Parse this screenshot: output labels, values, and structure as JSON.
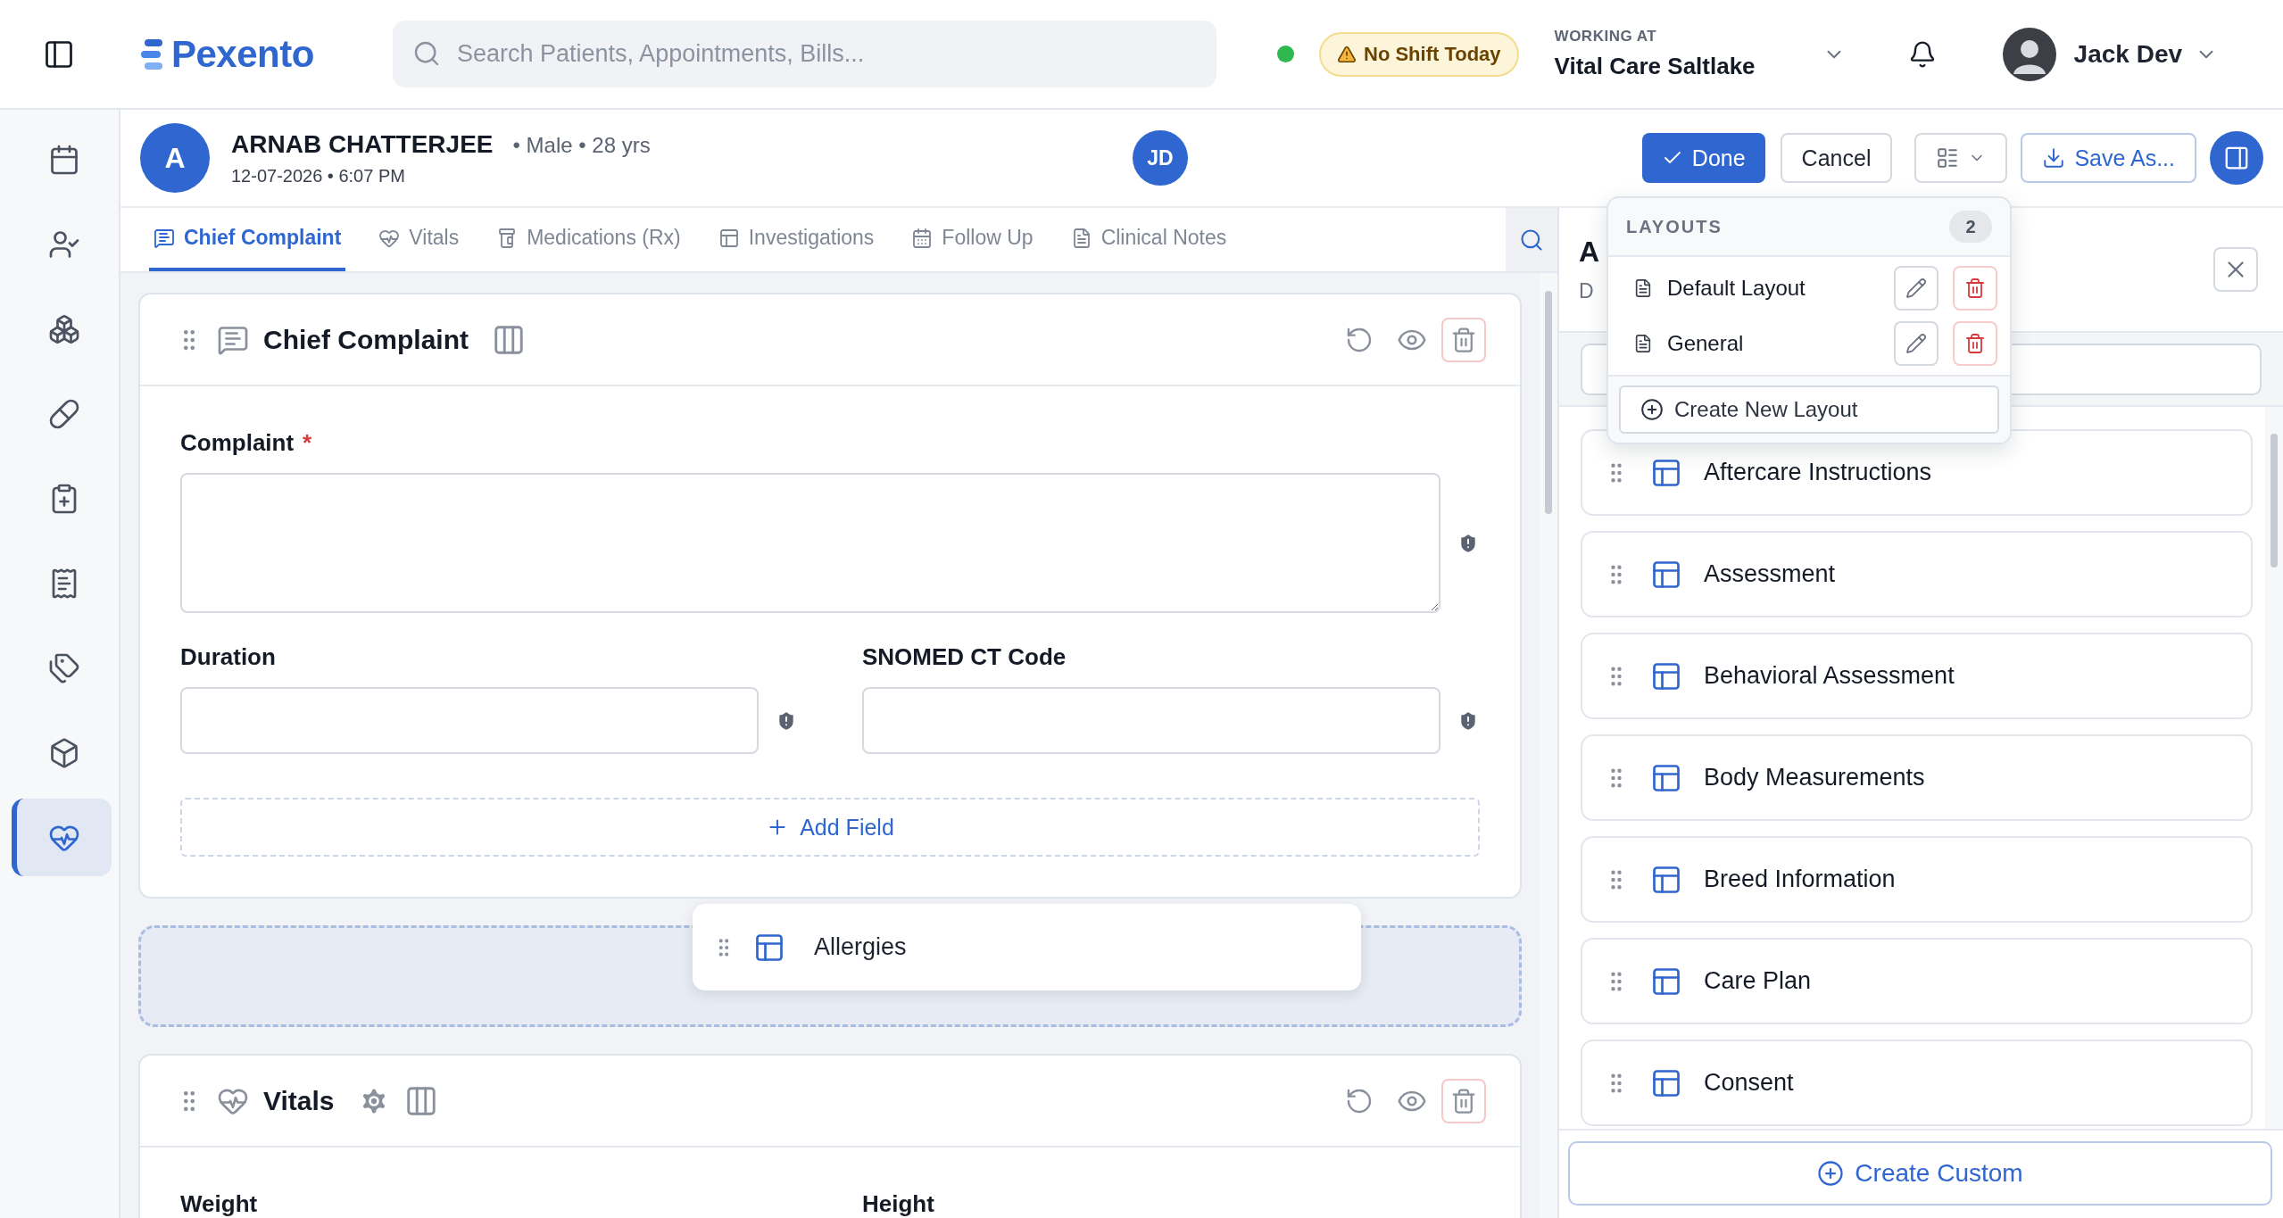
{
  "brand": "Pexento",
  "search": {
    "placeholder": "Search Patients, Appointments, Bills..."
  },
  "online": true,
  "shift_badge": "No Shift Today",
  "workplace": {
    "label": "WORKING AT",
    "name": "Vital Care Saltlake"
  },
  "user": {
    "name": "Jack Dev"
  },
  "sidebar": {
    "items": [
      {
        "kind": "calendar",
        "selected": false
      },
      {
        "kind": "patients",
        "selected": false
      },
      {
        "kind": "inventory",
        "selected": false
      },
      {
        "kind": "pharmacy",
        "selected": false
      },
      {
        "kind": "reports",
        "selected": false
      },
      {
        "kind": "billing",
        "selected": false
      },
      {
        "kind": "tags",
        "selected": false
      },
      {
        "kind": "products",
        "selected": false
      },
      {
        "kind": "clinical",
        "selected": true
      }
    ]
  },
  "patient": {
    "initial": "A",
    "name": "ARNAB CHATTERJEE",
    "details": "• Male • 28 yrs",
    "datetime": "12-07-2026 • 6:07 PM"
  },
  "assignee": "JD",
  "actions": {
    "done": "Done",
    "cancel": "Cancel",
    "save_as": "Save As..."
  },
  "tabs": [
    {
      "kind": "complaint",
      "label": "Chief Complaint",
      "selected": true
    },
    {
      "kind": "vitals",
      "label": "Vitals",
      "selected": false
    },
    {
      "kind": "medications",
      "label": "Medications (Rx)",
      "selected": false
    },
    {
      "kind": "investigations",
      "label": "Investigations",
      "selected": false
    },
    {
      "kind": "followup",
      "label": "Follow Up",
      "selected": false
    },
    {
      "kind": "notes",
      "label": "Clinical Notes",
      "selected": false
    }
  ],
  "sections": [
    {
      "kind": "complaint",
      "title": "Chief Complaint",
      "settings": false,
      "fields": [
        {
          "kind": "textarea",
          "label": "Complaint",
          "required_mark": "*"
        },
        {
          "kind": "input",
          "label": "Duration"
        },
        {
          "kind": "input",
          "label": "SNOMED CT Code"
        }
      ],
      "add_field": "Add Field"
    },
    {
      "kind": "vitals",
      "title": "Vitals",
      "settings": true,
      "fields": [
        {
          "kind": "cut",
          "label": "Weight"
        },
        {
          "kind": "cut",
          "label": "Height"
        }
      ]
    }
  ],
  "dragging": {
    "label": "Allergies"
  },
  "layouts_menu": {
    "title": "LAYOUTS",
    "count": "2",
    "items": [
      {
        "name": "Default Layout"
      },
      {
        "name": "General"
      }
    ],
    "create": "Create New Layout"
  },
  "right_panel": {
    "title": "A",
    "subtitle": "D",
    "items": [
      {
        "name": "Aftercare Instructions"
      },
      {
        "name": "Assessment"
      },
      {
        "name": "Behavioral Assessment"
      },
      {
        "name": "Body Measurements"
      },
      {
        "name": "Breed Information"
      },
      {
        "name": "Care Plan"
      },
      {
        "name": "Consent"
      }
    ],
    "create": "Create Custom"
  }
}
